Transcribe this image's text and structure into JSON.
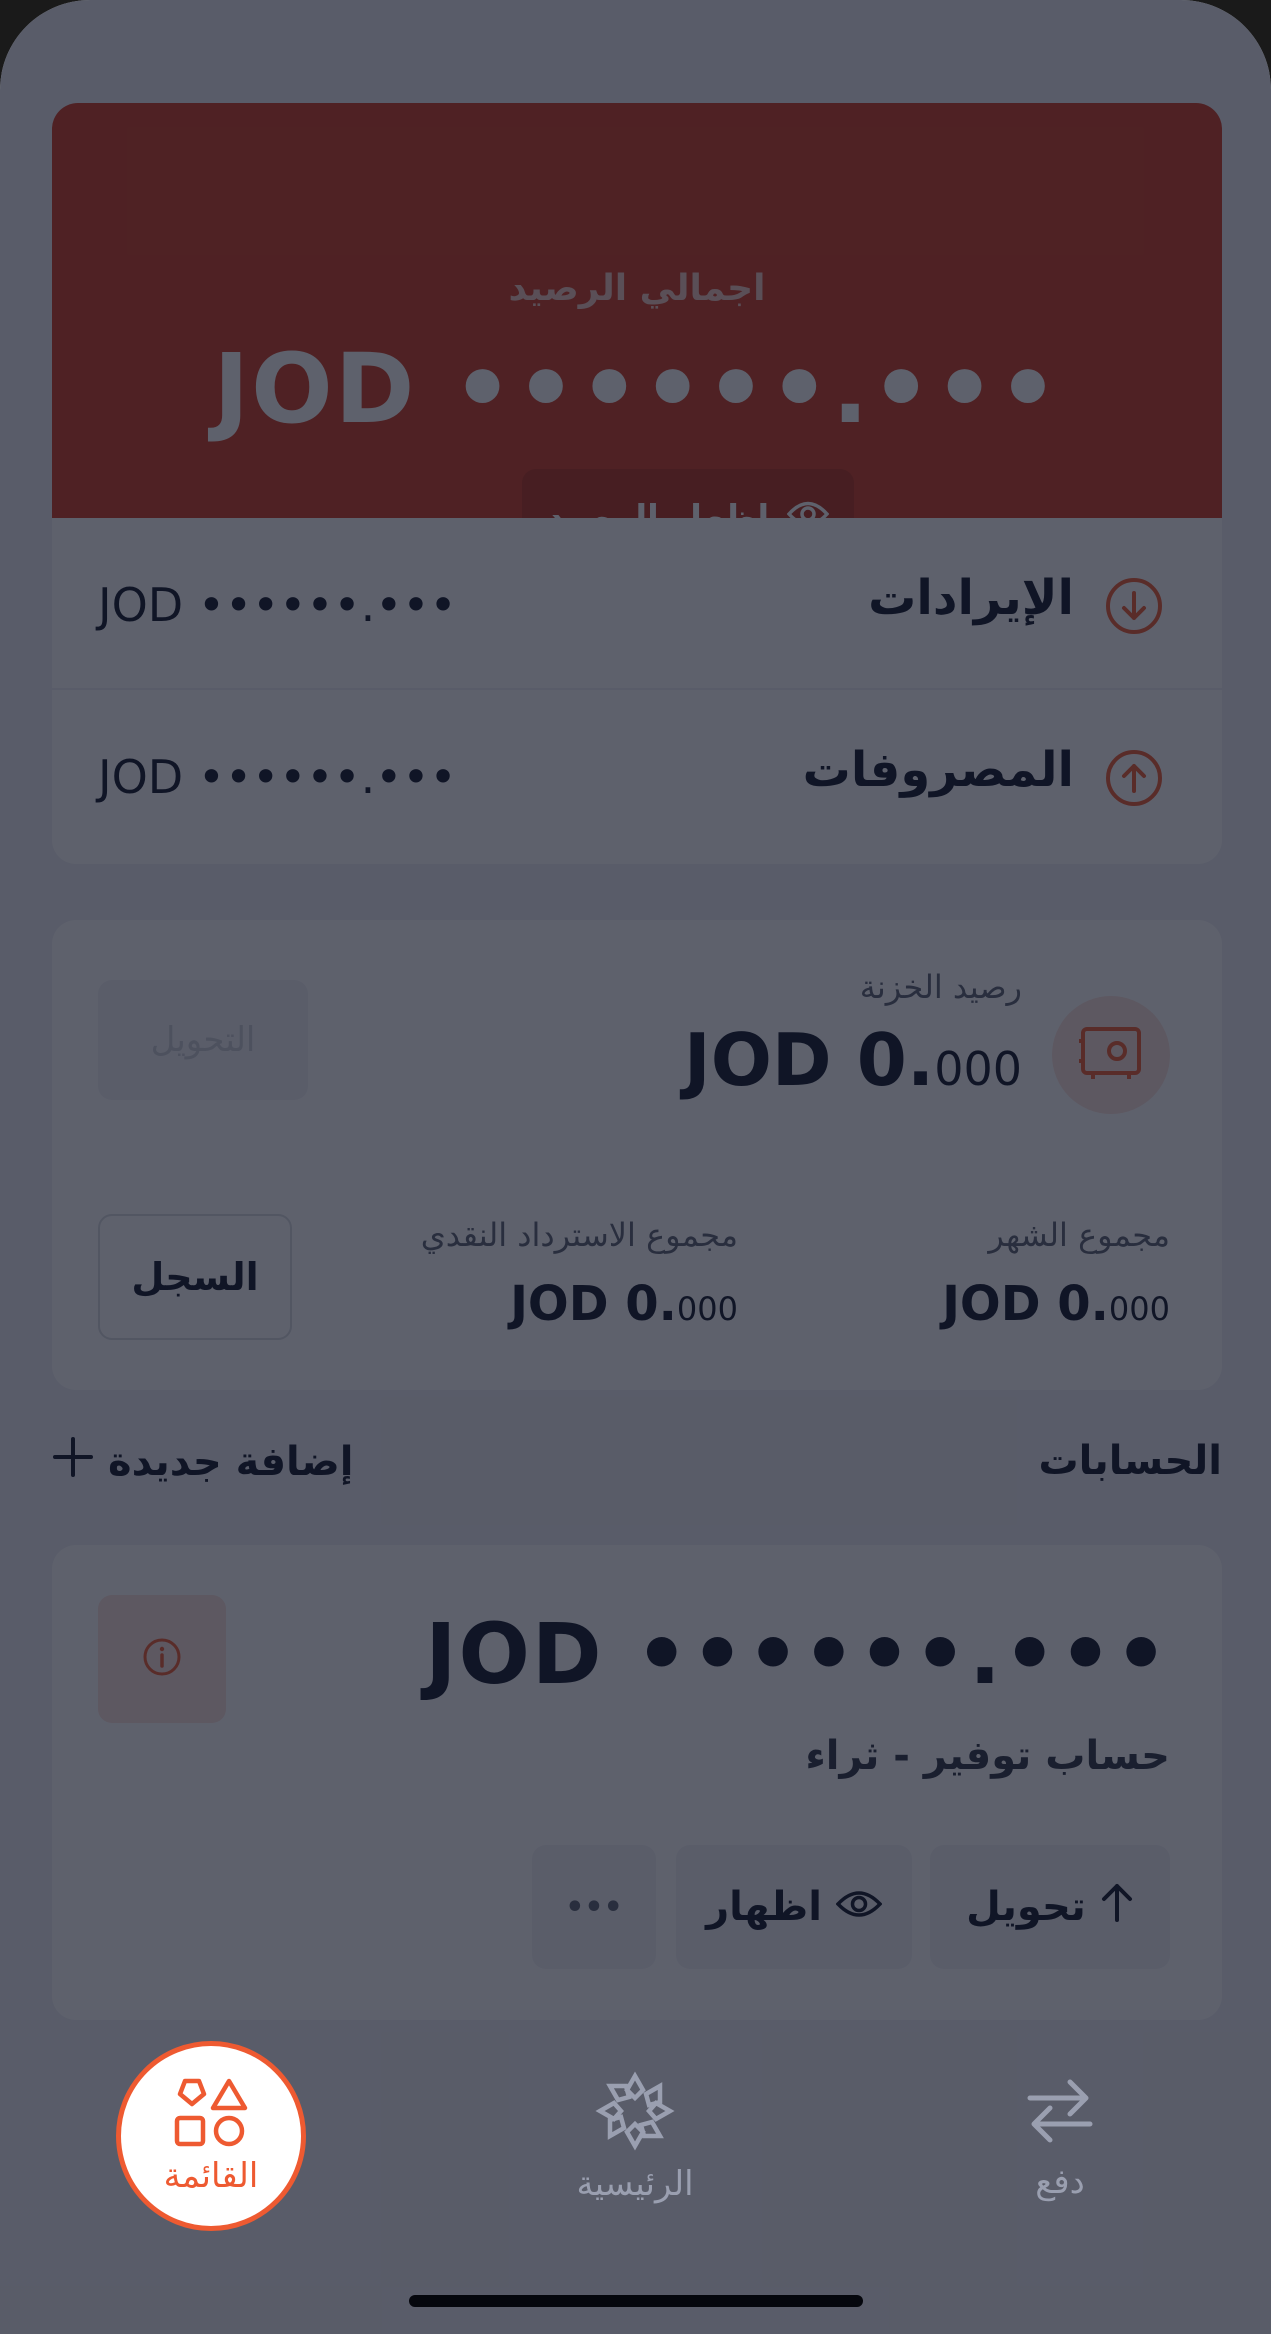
{
  "colors": {
    "brand": "#cf3a1f",
    "accent": "#ee5a31",
    "text": "#0d1327",
    "background": "#eef0f4"
  },
  "balance_card": {
    "label": "اجمالي الرصيد",
    "amount": "JOD ••••••.•••",
    "show_button_label": "اظهار الرصيد",
    "show_button_icon": "eye-icon"
  },
  "summary": {
    "income": {
      "label": "الإيرادات",
      "amount": "JOD ••••••.•••",
      "icon": "arrow-down-circle-icon"
    },
    "expenses": {
      "label": "المصروفات",
      "amount": "JOD ••••••.•••",
      "icon": "arrow-up-circle-icon"
    }
  },
  "vault": {
    "title": "رصيد الخزنة",
    "amount_main": "JOD 0.",
    "amount_fraction": "000",
    "action_label": "التحويل",
    "icon": "safe-icon",
    "month_total_label": "مجموع الشهر",
    "month_total_main": "JOD 0.",
    "month_total_fraction": "000",
    "cashback_label": "مجموع الاسترداد النقدي",
    "cashback_main": "JOD 0.",
    "cashback_fraction": "000",
    "history_label": "السجل"
  },
  "accounts": {
    "section_title": "الحسابات",
    "add_new_label": "إضافة جديدة",
    "items": [
      {
        "amount": "JOD ••••••.•••",
        "name": "حساب توفير - ثراء",
        "transfer_label": "تحويل",
        "show_label": "اظهار",
        "more_label": "•••"
      }
    ]
  },
  "tabbar": {
    "menu_label": "القائمة",
    "home_label": "الرئيسية",
    "pay_label": "دفع"
  }
}
